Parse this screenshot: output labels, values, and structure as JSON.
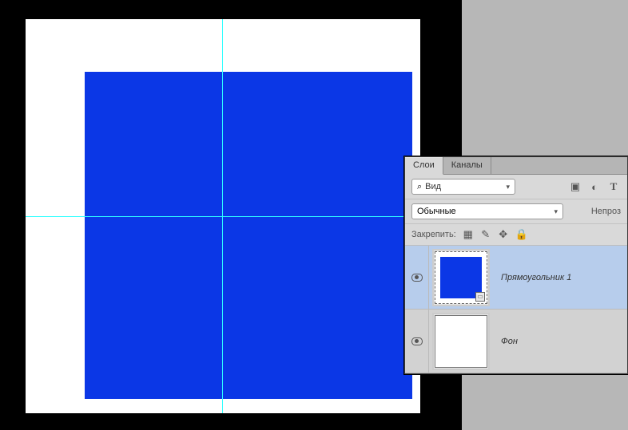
{
  "canvas": {
    "shape_color": "#0b37e6"
  },
  "panel": {
    "tabs": {
      "layers": "Слои",
      "channels": "Каналы"
    },
    "search": {
      "icon": "⌕",
      "label": "Вид",
      "chevron": "▾"
    },
    "filter_icons": {
      "image": "▣",
      "adjust": "◐",
      "type": "T"
    },
    "blend": {
      "mode": "Обычные",
      "chevron": "▾",
      "opacity_label": "Непроз"
    },
    "lock": {
      "label": "Закрепить:",
      "pixels": "▦",
      "brush": "✎",
      "move": "✥",
      "all": "🔒"
    },
    "layers": [
      {
        "name": "Прямоугольник 1",
        "visible": true,
        "type": "shape",
        "selected": true
      },
      {
        "name": "Фон",
        "visible": true,
        "type": "background",
        "selected": false
      }
    ]
  }
}
